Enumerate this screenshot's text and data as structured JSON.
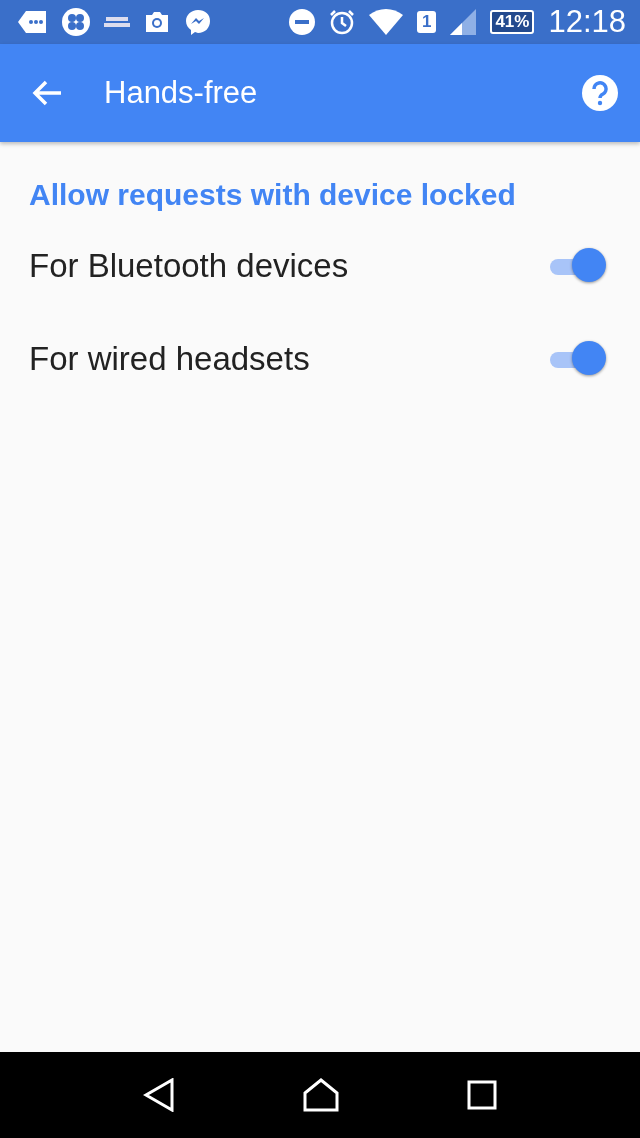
{
  "status_bar": {
    "sim_slot": "1",
    "battery": "41%",
    "time": "12:18"
  },
  "app_bar": {
    "title": "Hands-free"
  },
  "section": {
    "header": "Allow requests with device locked",
    "settings": [
      {
        "label": "For Bluetooth devices",
        "on": true
      },
      {
        "label": "For wired headsets",
        "on": true
      }
    ]
  }
}
